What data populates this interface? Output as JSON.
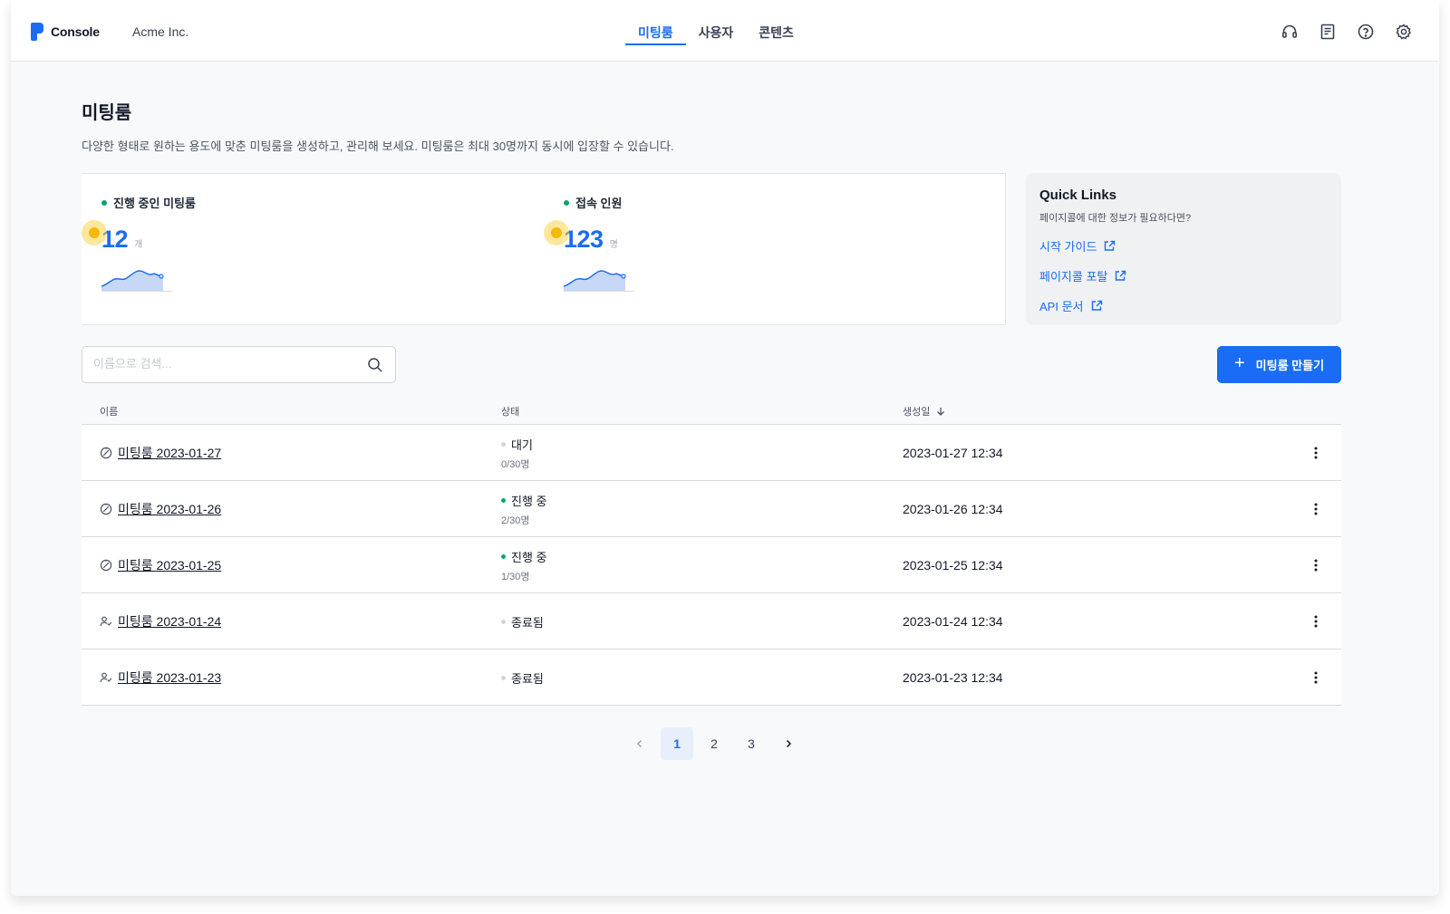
{
  "app": {
    "brand": "Console",
    "org": "Acme Inc."
  },
  "nav": {
    "tabs": [
      {
        "label": "미팅룸",
        "active": true
      },
      {
        "label": "사용자",
        "active": false
      },
      {
        "label": "콘텐츠",
        "active": false
      }
    ],
    "icons": [
      "headset-icon",
      "document-icon",
      "help-icon",
      "settings-icon"
    ]
  },
  "page": {
    "title": "미팅룸",
    "description": "다양한 형태로 원하는 용도에 맞춘 미팅룸을 생성하고, 관리해 보세요. 미팅룸은 최대 30명까지 동시에 입장할 수 있습니다."
  },
  "stats": [
    {
      "label": "진행 중인 미팅룸",
      "value": "12",
      "unit": "개"
    },
    {
      "label": "접속 인원",
      "value": "123",
      "unit": "명"
    }
  ],
  "quick_links": {
    "title": "Quick Links",
    "subtitle": "페이지콜에 대한 정보가 필요하다면?",
    "links": [
      {
        "label": "시작 가이드"
      },
      {
        "label": "페이지콜 포탈"
      },
      {
        "label": "API 문서"
      }
    ]
  },
  "search": {
    "placeholder": "이름으로 검색...",
    "value": ""
  },
  "create_button": {
    "label": "미팅룸 만들기"
  },
  "table": {
    "columns": {
      "name": "이름",
      "status": "상태",
      "created": "생성일"
    },
    "rows": [
      {
        "name": "미팅룸 2023-01-27",
        "icon": "timer-icon",
        "status": "대기",
        "status_color": "#d1d5db",
        "count": "0/30명",
        "created": "2023-01-27 12:34"
      },
      {
        "name": "미팅룸 2023-01-26",
        "icon": "timer-icon",
        "status": "진행 중",
        "status_color": "#10a36b",
        "count": "2/30명",
        "created": "2023-01-26 12:34"
      },
      {
        "name": "미팅룸 2023-01-25",
        "icon": "timer-icon",
        "status": "진행 중",
        "status_color": "#10a36b",
        "count": "1/30명",
        "created": "2023-01-25 12:34"
      },
      {
        "name": "미팅룸 2023-01-24",
        "icon": "user-check-icon",
        "status": "종료됨",
        "status_color": "#d1d5db",
        "count": "",
        "created": "2023-01-24 12:34"
      },
      {
        "name": "미팅룸 2023-01-23",
        "icon": "user-check-icon",
        "status": "종료됨",
        "status_color": "#d1d5db",
        "count": "",
        "created": "2023-01-23 12:34"
      }
    ]
  },
  "pagination": {
    "pages": [
      "1",
      "2",
      "3"
    ],
    "current": "1"
  },
  "colors": {
    "accent": "#1a6cf5",
    "live": "#10a36b",
    "idle": "#d1d5db"
  }
}
